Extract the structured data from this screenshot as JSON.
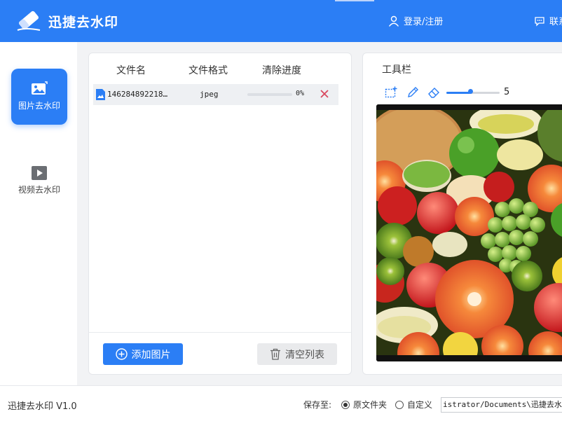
{
  "header": {
    "app_title": "迅捷去水印",
    "login_label": "登录/注册",
    "contact_label": "联系"
  },
  "sidebar": {
    "items": [
      {
        "label": "图片去水印",
        "icon": "image-icon",
        "active": true
      },
      {
        "label": "视频去水印",
        "icon": "video-play-icon",
        "active": false
      }
    ]
  },
  "file_list": {
    "columns": [
      "文件名",
      "文件格式",
      "清除进度"
    ],
    "rows": [
      {
        "name": "146284892218…",
        "format": "jpeg",
        "progress_text": "0%",
        "progress": 0
      }
    ],
    "add_button": "添加图片",
    "clear_button": "清空列表"
  },
  "toolbar": {
    "title": "工具栏",
    "tools": [
      "rect-select-icon",
      "pencil-icon",
      "eraser-icon"
    ],
    "brush_size": "5",
    "slider_fraction": 0.45
  },
  "statusbar": {
    "version": "迅捷去水印 V1.0",
    "save_label": "保存至:",
    "options": [
      "原文件夹",
      "自定义"
    ],
    "selected_option": 0,
    "path": "istrator/Documents\\迅捷去水印"
  },
  "colors": {
    "primary": "#2b7ef5",
    "background": "#f2f3f5",
    "delete": "#d9485f"
  }
}
